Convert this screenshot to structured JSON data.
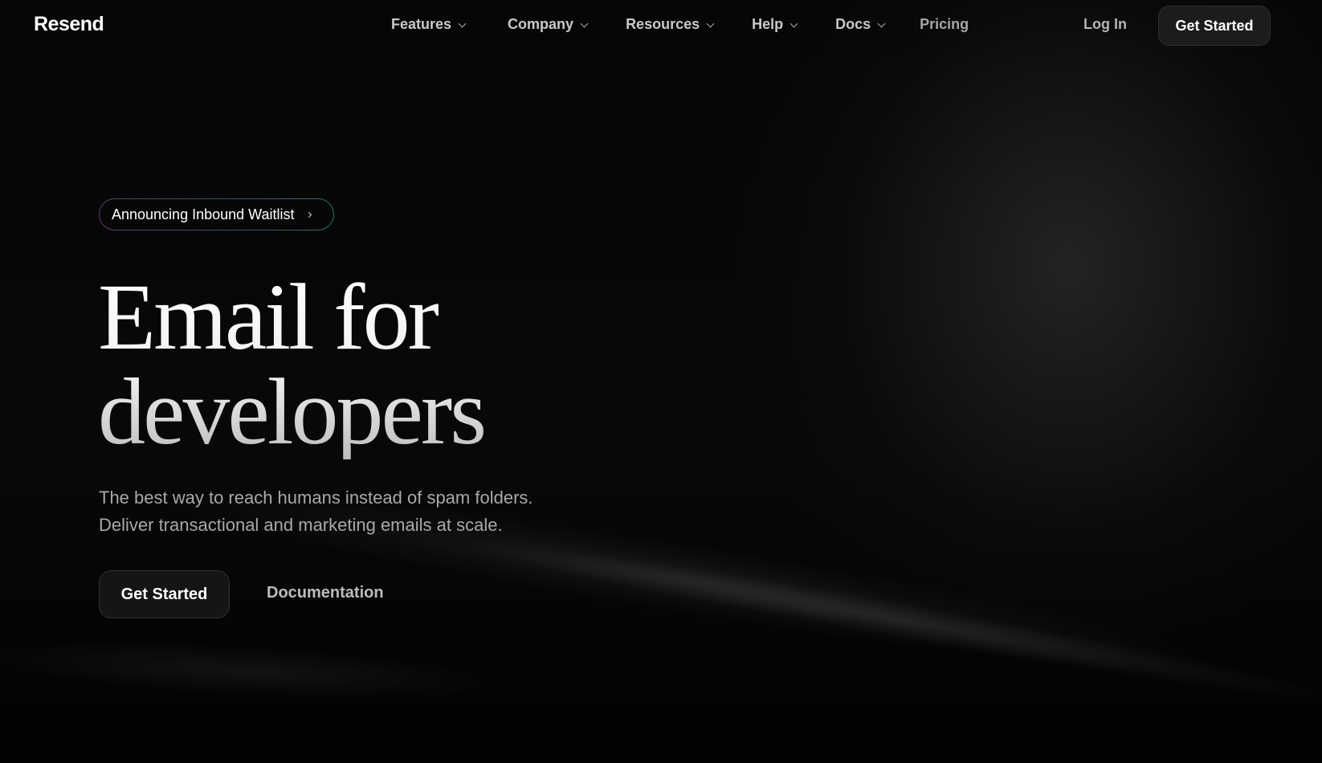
{
  "brand": {
    "logo_text": "Resend"
  },
  "nav": {
    "items": [
      {
        "label": "Features",
        "has_dropdown": true
      },
      {
        "label": "Company",
        "has_dropdown": true
      },
      {
        "label": "Resources",
        "has_dropdown": true
      },
      {
        "label": "Help",
        "has_dropdown": true
      },
      {
        "label": "Docs",
        "has_dropdown": true
      },
      {
        "label": "Pricing",
        "has_dropdown": false
      }
    ],
    "login_label": "Log In",
    "cta_label": "Get Started"
  },
  "hero": {
    "announcement": "Announcing Inbound Waitlist",
    "headline_line1": "Email for",
    "headline_line2": "developers",
    "subtitle_line1": "The best way to reach humans instead of spam folders.",
    "subtitle_line2": "Deliver transactional and marketing emails at scale.",
    "primary_cta": "Get Started",
    "secondary_cta": "Documentation"
  },
  "colors": {
    "background": "#000000",
    "text": "#ffffff",
    "muted_text": "#a9a9a9",
    "button_bg": "#151515"
  }
}
